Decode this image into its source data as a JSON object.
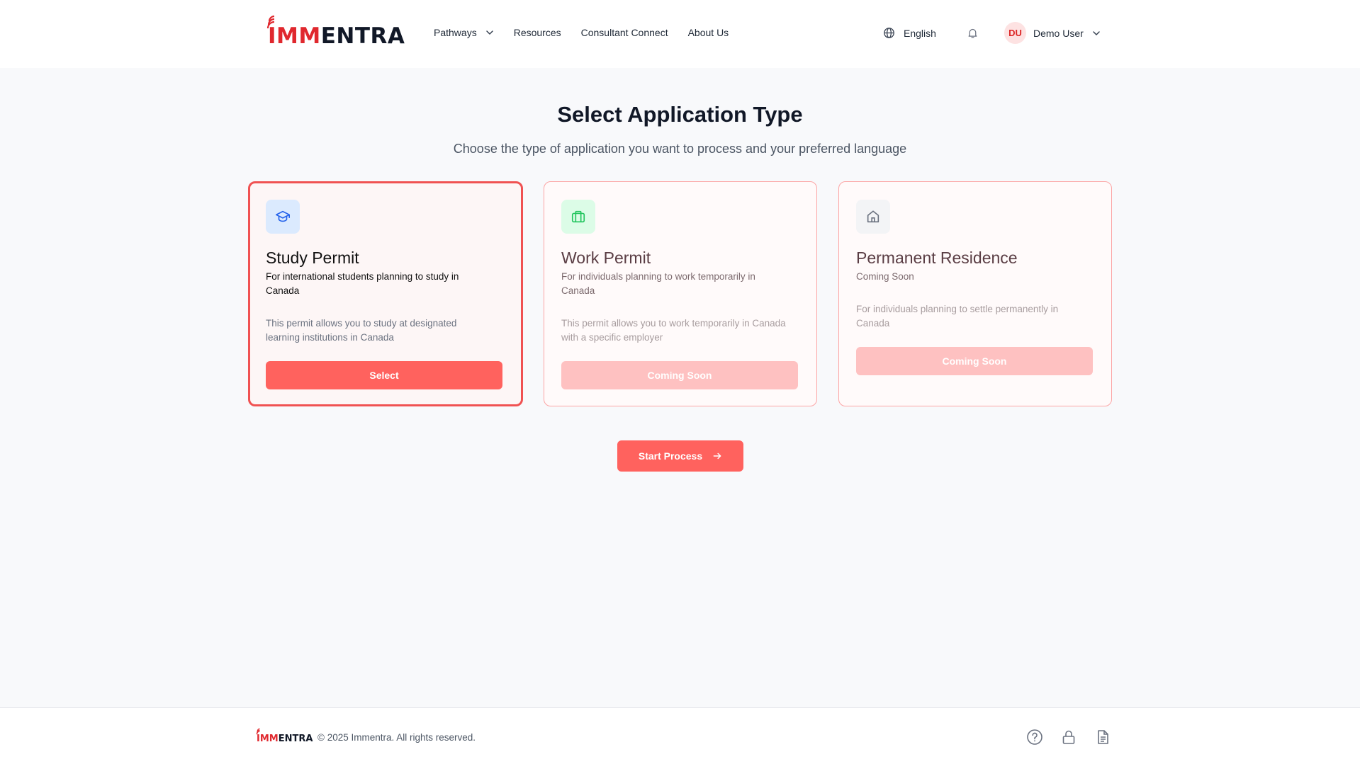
{
  "brand": {
    "name_red": "IMM",
    "name_dark": "ENTRA",
    "accent_color": "#e0282e"
  },
  "nav": {
    "items": [
      {
        "label": "Pathways",
        "has_dropdown": true
      },
      {
        "label": "Resources"
      },
      {
        "label": "Consultant Connect"
      },
      {
        "label": "About Us"
      }
    ]
  },
  "header": {
    "language": "English",
    "user": {
      "initials": "DU",
      "name": "Demo User"
    }
  },
  "main": {
    "title": "Select Application Type",
    "subtitle": "Choose the type of application you want to process and your preferred language",
    "cards": [
      {
        "icon": "graduation-cap-icon",
        "title": "Study Permit",
        "description": "For international students planning to study in Canada",
        "detail": "This permit allows you to study at designated learning institutions in Canada",
        "button_label": "Select",
        "selected": true
      },
      {
        "icon": "briefcase-icon",
        "title": "Work Permit",
        "description": "For individuals planning to work temporarily in Canada",
        "detail": "This permit allows you to work temporarily in Canada with a specific employer",
        "button_label": "Coming Soon",
        "selected": false
      },
      {
        "icon": "home-icon",
        "title": "Permanent Residence",
        "description": "Coming Soon",
        "detail": "For individuals planning to settle permanently in Canada",
        "button_label": "Coming Soon",
        "selected": false
      }
    ],
    "start_button": "Start Process"
  },
  "footer": {
    "copyright": "© 2025 Immentra. All rights reserved.",
    "icons": [
      "help-circle-icon",
      "lock-icon",
      "document-icon"
    ]
  },
  "colors": {
    "primary": "#ff625e",
    "disabled": "#fec1c1",
    "selected_border": "#f05252"
  }
}
